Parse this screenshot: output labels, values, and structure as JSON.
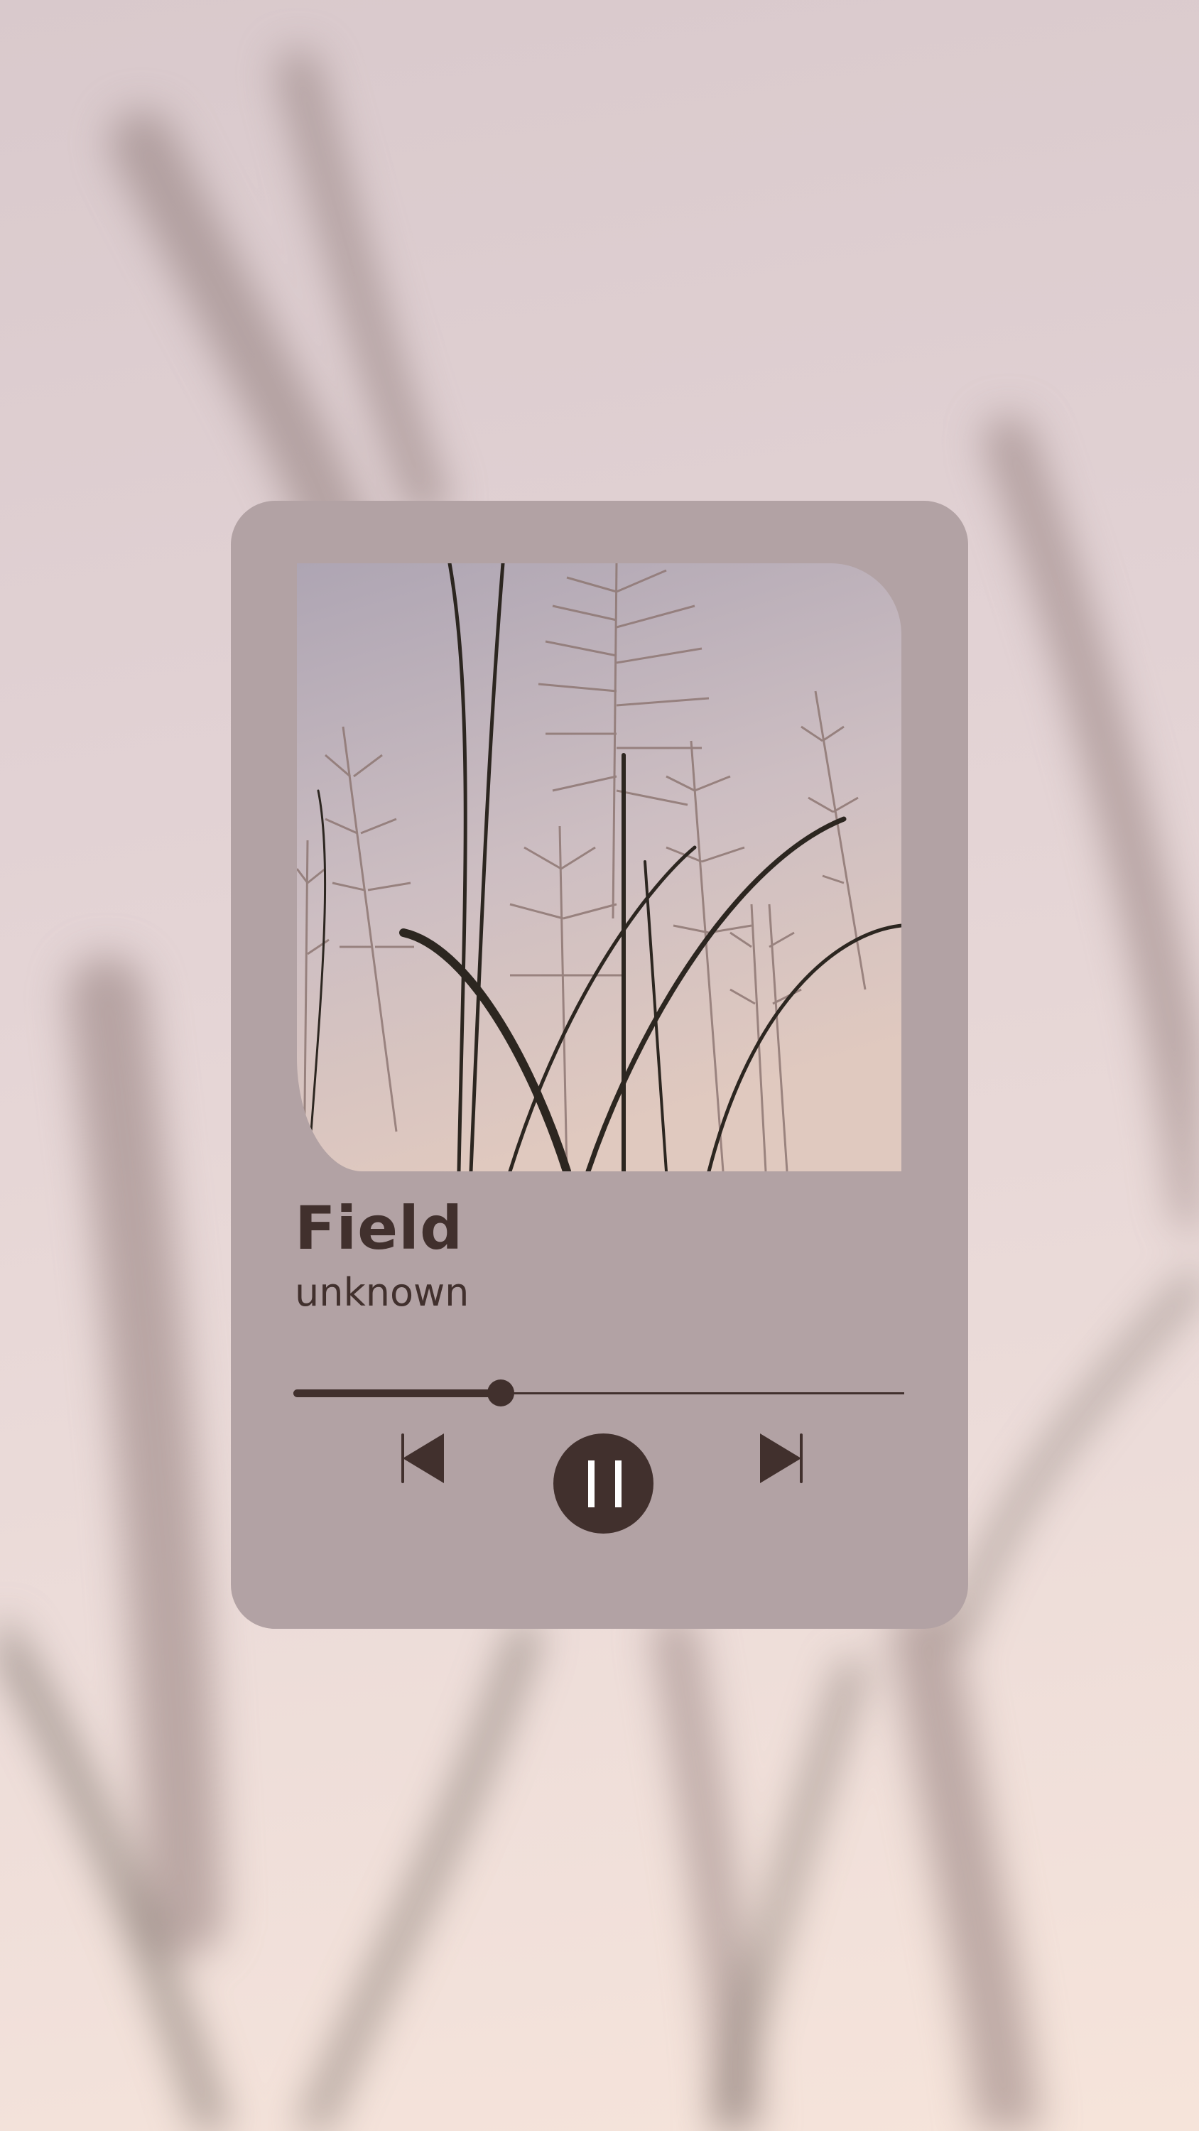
{
  "track": {
    "title": "Field",
    "artist": "unknown"
  },
  "player": {
    "progress_fraction": 0.34,
    "state": "playing"
  },
  "controls": {
    "previous_icon": "skip-previous-icon",
    "pause_icon": "pause-icon",
    "next_icon": "skip-next-icon"
  },
  "colors": {
    "card": "#b2a2a4",
    "accent": "#41302d",
    "background": "#e4d4d4"
  }
}
